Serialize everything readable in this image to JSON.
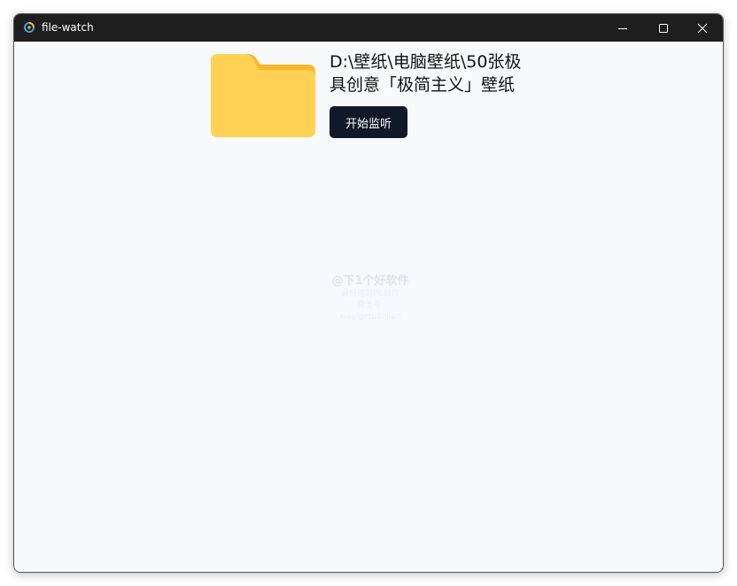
{
  "window": {
    "title": "file-watch",
    "title_icon": "app-logo-icon",
    "controls": {
      "minimize_icon": "minimize-icon",
      "maximize_icon": "maximize-icon",
      "close_icon": "close-icon"
    }
  },
  "main": {
    "folder_icon": "folder-icon",
    "folder_path": "D:\\壁纸\\电脑壁纸\\50张极具创意「极简主义」壁纸",
    "start_button_label": "开始监听"
  },
  "watermark": {
    "main": "@下1个好软件",
    "sub1": "最好用的PC软件",
    "sub2": "微信号: xiayigeruanjian"
  },
  "colors": {
    "titlebar": "#1e1e1e",
    "content_bg": "#f8f9fb",
    "button_bg": "#111827",
    "folder_front": "#ffd256",
    "folder_back": "#fbb62a"
  }
}
